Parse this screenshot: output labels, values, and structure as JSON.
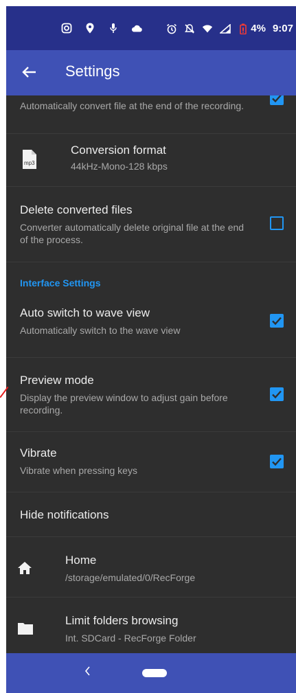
{
  "status_bar": {
    "battery_percent": "4%",
    "time": "9:07",
    "icons": [
      "instagram-icon",
      "location-icon",
      "mic-icon",
      "cloud-icon",
      "alarm-icon",
      "mute-icon",
      "wifi-icon",
      "signal-icon",
      "battery-low-icon"
    ]
  },
  "app_bar": {
    "title": "Settings"
  },
  "settings": {
    "auto_convert": {
      "subtitle": "Automatically convert file at the end of the recording.",
      "checked": true
    },
    "conversion_format": {
      "title": "Conversion format",
      "subtitle": "44kHz-Mono-128 kbps",
      "icon_label": "mp3"
    },
    "delete_converted": {
      "title": "Delete converted files",
      "subtitle": "Converter automatically delete original file at the end of the process.",
      "checked": false
    },
    "section_interface": "Interface Settings",
    "auto_switch": {
      "title": "Auto switch to wave view",
      "subtitle": "Automatically switch to the wave view",
      "checked": true
    },
    "preview_mode": {
      "title": "Preview mode",
      "subtitle": "Display the preview window to adjust gain before recording.",
      "checked": true
    },
    "vibrate": {
      "title": "Vibrate",
      "subtitle": "Vibrate when pressing keys",
      "checked": true
    },
    "hide_notifications": {
      "title": "Hide notifications"
    },
    "home": {
      "title": "Home",
      "subtitle": "/storage/emulated/0/RecForge"
    },
    "limit_folders": {
      "title": "Limit folders browsing",
      "subtitle": "Int. SDCard - RecForge Folder"
    }
  },
  "colors": {
    "accent": "#2196f3",
    "app_bar": "#3f51b5",
    "status_bar": "#27308a",
    "background": "#2e2e2e"
  }
}
